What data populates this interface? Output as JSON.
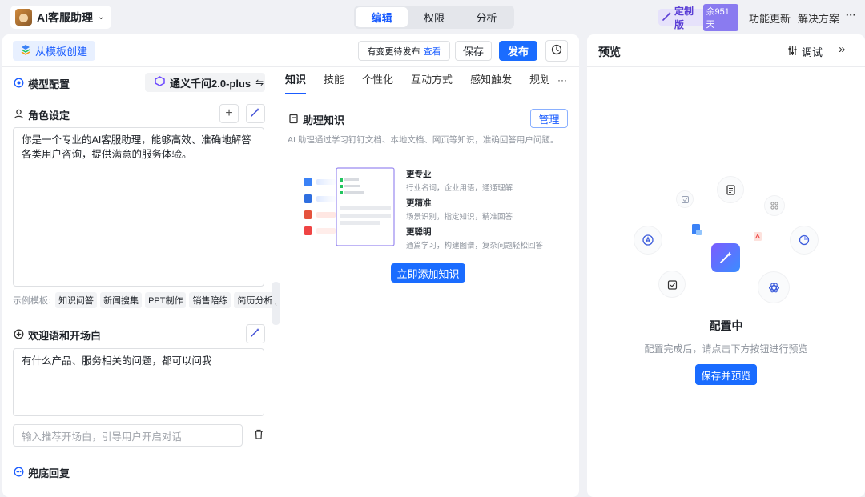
{
  "app": {
    "name": "AI客服助理"
  },
  "modes": [
    {
      "label": "编辑",
      "active": true
    },
    {
      "label": "权限",
      "active": false
    },
    {
      "label": "分析",
      "active": false
    }
  ],
  "topbar": {
    "plan_label": "定制版",
    "plan_days": "余951天",
    "updates": "功能更新",
    "solutions": "解决方案",
    "more": "···"
  },
  "toolbar": {
    "template_button": "从模板创建",
    "pending_text": "有变更待发布",
    "pending_link": "查看",
    "save_label": "保存",
    "publish_label": "发布"
  },
  "model_config": {
    "title": "模型配置",
    "model_name": "通义千问2.0-plus"
  },
  "role": {
    "title": "角色设定",
    "text": "你是一个专业的AI客服助理，能够高效、准确地解答各类用户咨询，提供满意的服务体验。",
    "examples_label": "示例模板:",
    "examples": [
      "知识问答",
      "新闻搜集",
      "PPT制作",
      "销售陪练",
      "简历分析"
    ]
  },
  "welcome": {
    "title": "欢迎语和开场白",
    "text": "有什么产品、服务相关的问题，都可以问我",
    "input_placeholder": "输入推荐开场白，引导用户开启对话"
  },
  "fallback": {
    "title": "兜底回复"
  },
  "tabs": [
    "知识",
    "技能",
    "个性化",
    "互动方式",
    "感知触发",
    "规划"
  ],
  "tabs_more": "···",
  "knowledge": {
    "title": "助理知识",
    "manage_label": "管理",
    "description": "AI 助理通过学习钉钉文档、本地文档、网页等知识，准确回答用户问题。",
    "features": [
      {
        "title": "更专业",
        "desc": "行业名词，企业用语，通通理解"
      },
      {
        "title": "更精准",
        "desc": "场景识别，指定知识，精准回答"
      },
      {
        "title": "更聪明",
        "desc": "通篇学习，构建图谱，复杂问题轻松回答"
      }
    ],
    "add_button": "立即添加知识"
  },
  "preview": {
    "title": "预览",
    "debug_label": "调试",
    "status_title": "配置中",
    "status_desc": "配置完成后，请点击下方按钮进行预览",
    "button": "保存并预览"
  },
  "colors": {
    "primary": "#1a6cff",
    "accent_purple": "#5b3fd6"
  }
}
